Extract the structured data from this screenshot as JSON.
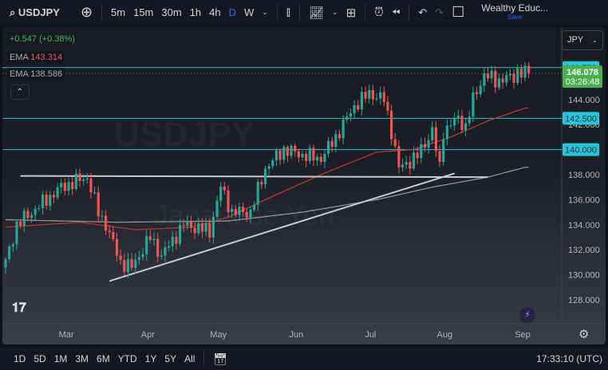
{
  "toolbar": {
    "symbol": "USDJPY",
    "intervals": [
      "5m",
      "15m",
      "30m",
      "1h",
      "4h",
      "D",
      "W"
    ],
    "active_interval": "D",
    "account": "Wealthy Educ...",
    "save": "Save"
  },
  "legend": {
    "change": "+0.547 (+0.38%)",
    "ema1_label": "EMA",
    "ema1_value": "143.314",
    "ema2_label": "EMA",
    "ema2_value": "138.586"
  },
  "currency": "JPY",
  "watermark": {
    "symbol": "USDJPY",
    "name": "Japanese Yen"
  },
  "price_axis": {
    "ticks": [
      "144.000",
      "142.000",
      "140.000",
      "138.000",
      "136.000",
      "134.000",
      "132.000",
      "130.000",
      "128.000"
    ],
    "tick_values": [
      144,
      142,
      140,
      138,
      136,
      134,
      132,
      130,
      128
    ],
    "levels": [
      {
        "label": "146.550",
        "value": 146.55
      },
      {
        "label": "142.500",
        "value": 142.5
      },
      {
        "label": "140.000",
        "value": 140
      }
    ],
    "last_price": "146.078",
    "countdown": "03:26:48"
  },
  "time_axis": {
    "labels": [
      "Mar",
      "Apr",
      "May",
      "Jun",
      "Jul",
      "Aug",
      "Sep"
    ],
    "label_days": [
      17,
      39,
      58,
      79,
      99,
      119,
      140
    ]
  },
  "bottom": {
    "ranges": [
      "1D",
      "5D",
      "1M",
      "3M",
      "6M",
      "YTD",
      "1Y",
      "5Y",
      "All"
    ],
    "clock": "17:33:10 (UTC)"
  },
  "colors": {
    "up": "#26a69a",
    "down": "#ef5350",
    "level": "#26c6da",
    "ema_fast": "#c0392b",
    "ema_slow": "#9a9a9a",
    "last": "#4caf50"
  },
  "chart_data": {
    "type": "candlestick",
    "symbol": "USDJPY",
    "ylim": [
      126.5,
      148
    ],
    "days": 141,
    "close_waypoints": [
      [
        0,
        131
      ],
      [
        3,
        134
      ],
      [
        15,
        137
      ],
      [
        22,
        137.8
      ],
      [
        25,
        135
      ],
      [
        27,
        134
      ],
      [
        31,
        131
      ],
      [
        34,
        130.6
      ],
      [
        39,
        133
      ],
      [
        42,
        131.5
      ],
      [
        48,
        134
      ],
      [
        55,
        133.5
      ],
      [
        58,
        137
      ],
      [
        61,
        135
      ],
      [
        66,
        135
      ],
      [
        70,
        138.5
      ],
      [
        75,
        140
      ],
      [
        81,
        139.5
      ],
      [
        85,
        139.3
      ],
      [
        89,
        141
      ],
      [
        94,
        143.5
      ],
      [
        98,
        144.5
      ],
      [
        102,
        144
      ],
      [
        104,
        141.5
      ],
      [
        106,
        138.5
      ],
      [
        111,
        139.5
      ],
      [
        115,
        141.5
      ],
      [
        117,
        138.5
      ],
      [
        118,
        141.5
      ],
      [
        122,
        142.5
      ],
      [
        124,
        141.8
      ],
      [
        126,
        144
      ],
      [
        129,
        146
      ],
      [
        132,
        145.5
      ],
      [
        137,
        145.8
      ],
      [
        138,
        146.3
      ],
      [
        140,
        146.08
      ]
    ],
    "ema_fast": [
      [
        0,
        133.8
      ],
      [
        20,
        134.2
      ],
      [
        35,
        133.6
      ],
      [
        50,
        133.8
      ],
      [
        60,
        134.6
      ],
      [
        70,
        136
      ],
      [
        85,
        138
      ],
      [
        100,
        139.8
      ],
      [
        110,
        140
      ],
      [
        120,
        141
      ],
      [
        130,
        142.3
      ],
      [
        140,
        143.314
      ]
    ],
    "ema_slow": [
      [
        0,
        134.4
      ],
      [
        30,
        134.2
      ],
      [
        60,
        134.3
      ],
      [
        80,
        135
      ],
      [
        100,
        136
      ],
      [
        115,
        137
      ],
      [
        130,
        137.8
      ],
      [
        140,
        138.586
      ]
    ],
    "support_line": {
      "from": [
        4,
        137.9
      ],
      "to": [
        130,
        137.8
      ]
    },
    "trendline": {
      "from": [
        28,
        129.5
      ],
      "to": [
        121,
        138.1
      ]
    }
  }
}
